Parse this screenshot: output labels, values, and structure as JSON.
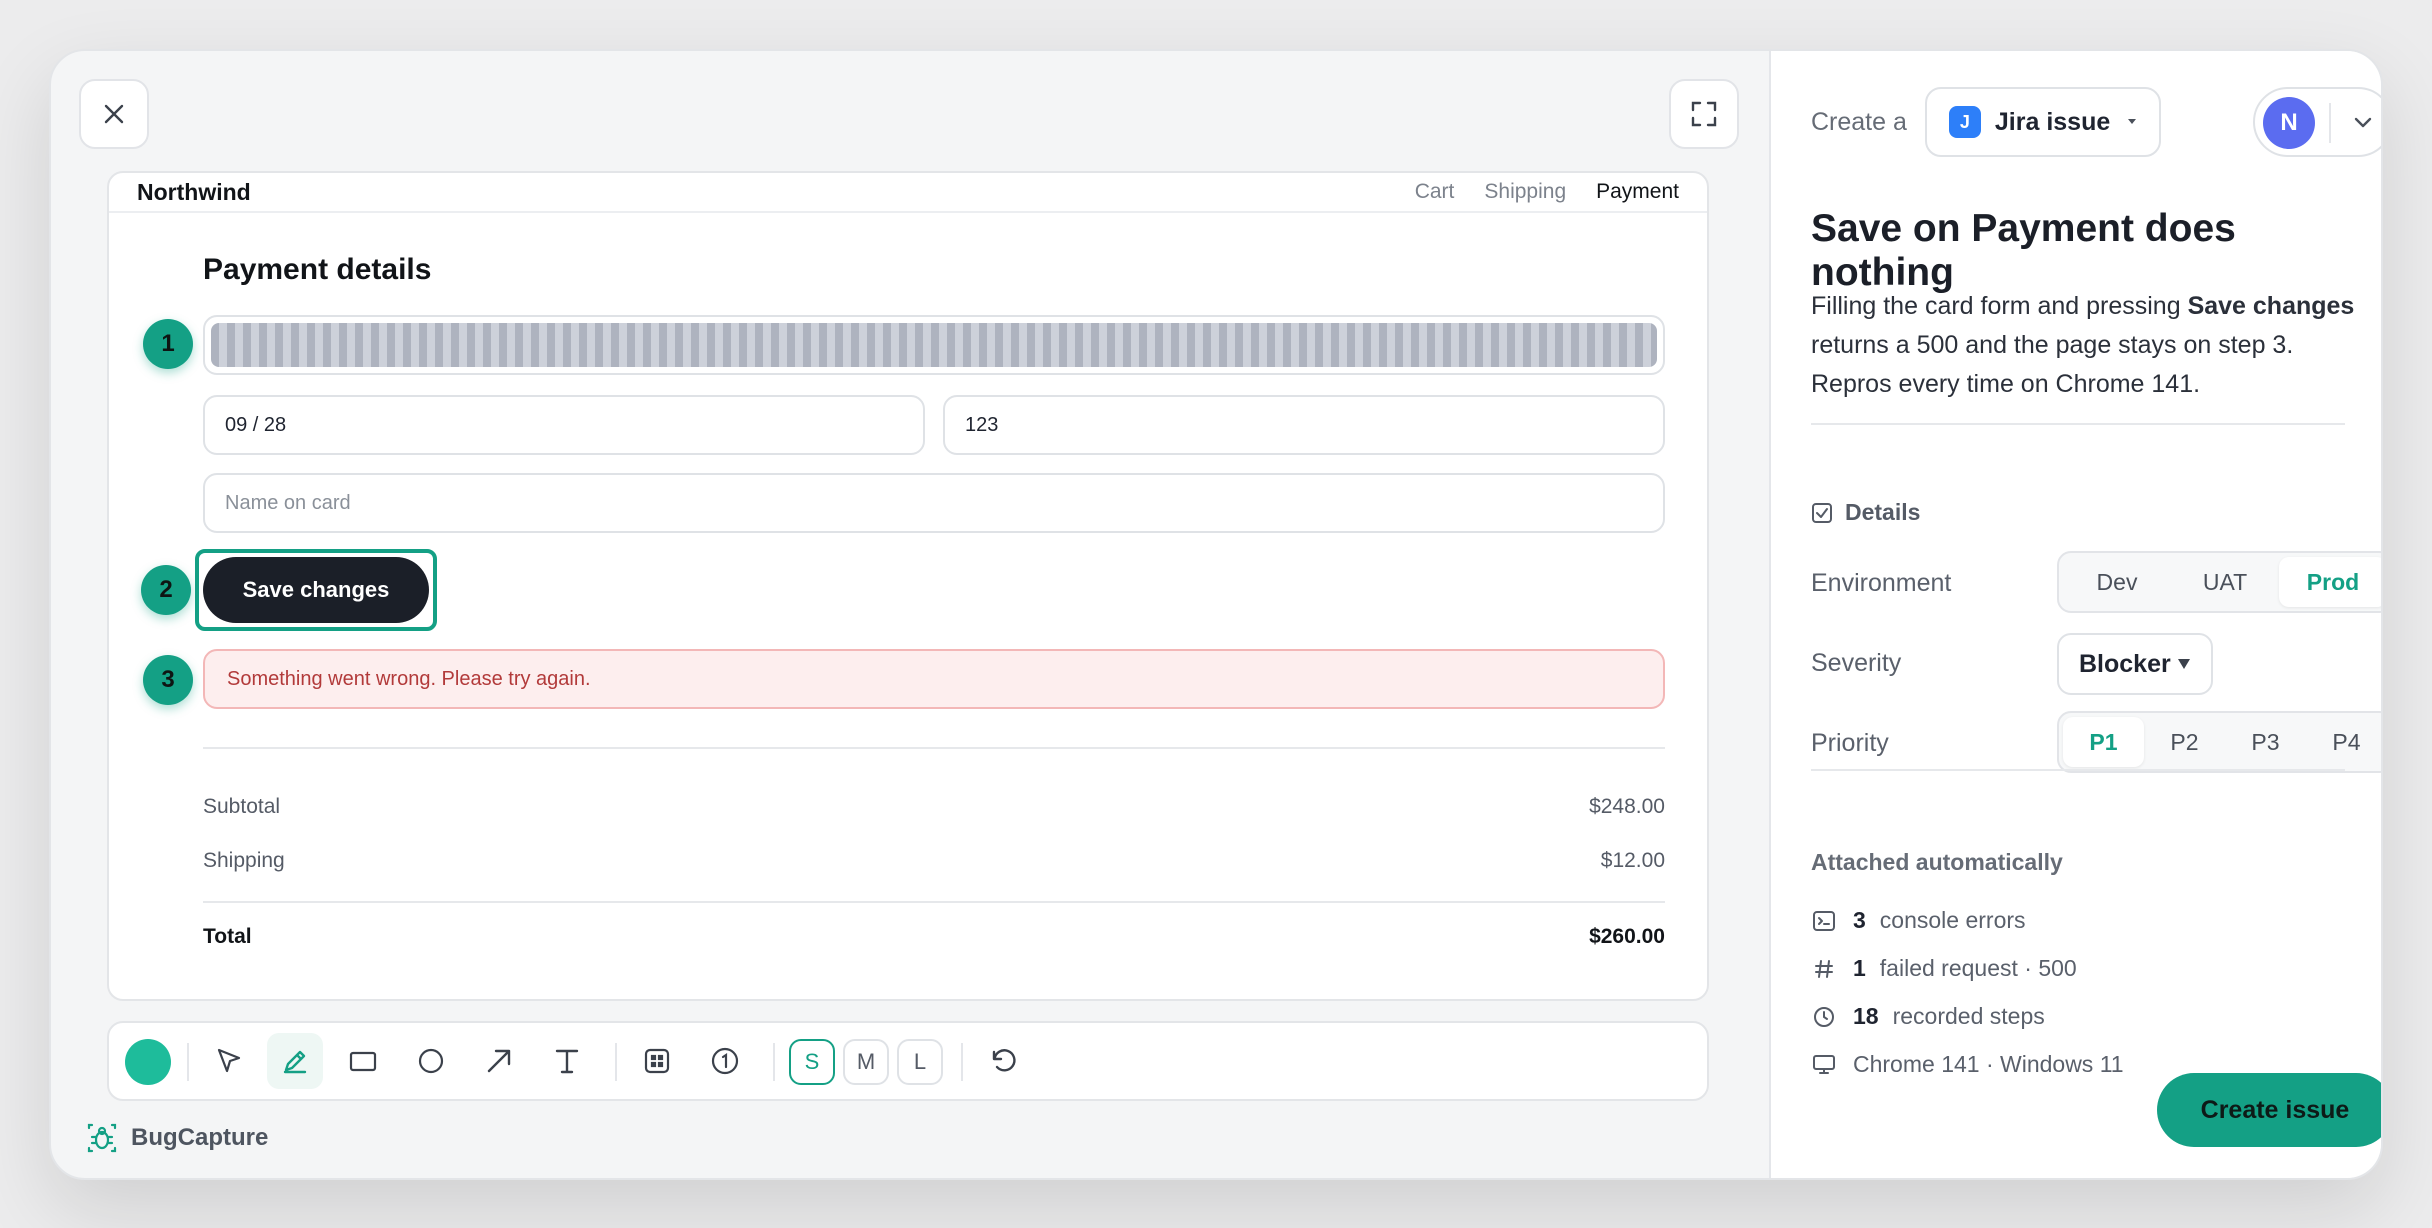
{
  "preview": {
    "brand": "Northwind",
    "steps": [
      "Cart",
      "Shipping",
      "Payment"
    ],
    "title": "Payment details",
    "expiry": "09 / 28",
    "cvc": "123",
    "name_placeholder": "Name on card",
    "save_label": "Save changes",
    "error_message": "Something went wrong. Please try again.",
    "markers": [
      "1",
      "2",
      "3"
    ],
    "summary": {
      "subtotal_label": "Subtotal",
      "subtotal_value": "$248.00",
      "shipping_label": "Shipping",
      "shipping_value": "$12.00",
      "total_label": "Total",
      "total_value": "$260.00"
    }
  },
  "toolbar": {
    "color": "#1ebc9b",
    "sizes": [
      "S",
      "M",
      "L"
    ],
    "selected_size": "S",
    "tools": [
      "pointer-icon",
      "pen-icon",
      "rectangle-icon",
      "circle-icon",
      "arrow-icon",
      "text-icon",
      "blur-icon",
      "step-number-icon",
      "undo-icon"
    ]
  },
  "footer": {
    "brand": "BugCapture"
  },
  "panel": {
    "create_label": "Create a",
    "issue_type": "Jira issue",
    "issue_badge": "J",
    "assignee_initial": "N",
    "title": "Save on Payment does nothing",
    "desc_1": "Filling the card form and pressing ",
    "desc_bold": "Save changes",
    "desc_2": " returns a 500 and the page stays on step 3. Repros every time on Chrome 141.",
    "details_label": "Details",
    "environment_label": "Environment",
    "environments": [
      "Dev",
      "UAT",
      "Prod"
    ],
    "environment_selected": "Prod",
    "severity_label": "Severity",
    "severity_value": "Blocker",
    "priority_label": "Priority",
    "priorities": [
      "P1",
      "P2",
      "P3",
      "P4"
    ],
    "priority_selected": "P1",
    "attached_label": "Attached automatically",
    "attached": {
      "console_count": "3",
      "console_text": "console errors",
      "request_count": "1",
      "request_text": "failed request · 500",
      "steps_count": "18",
      "steps_text": "recorded steps",
      "env_text": "Chrome 141 · Windows 11"
    },
    "create_button": "Create issue"
  },
  "colors": {
    "accent": "#14a085",
    "error": "#b23a3a",
    "jira": "#2d7ff9",
    "avatar": "#5b6cf0"
  }
}
